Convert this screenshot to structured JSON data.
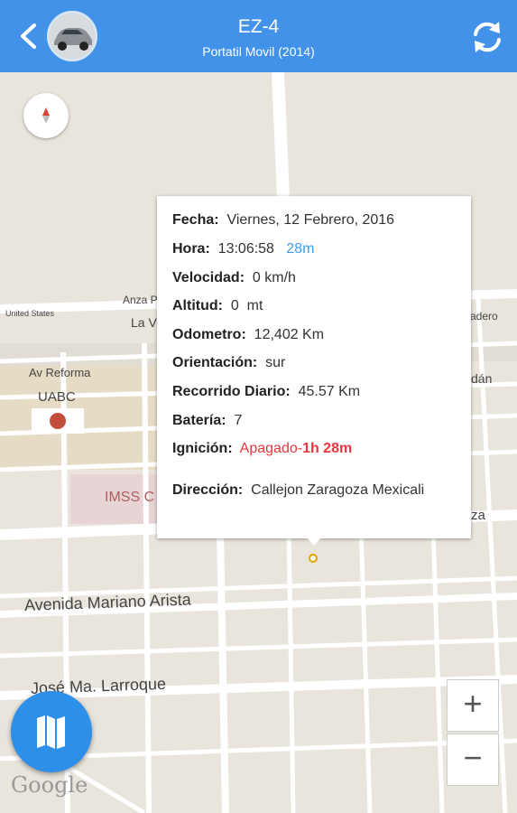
{
  "header": {
    "title": "EZ-4",
    "subtitle": "Portatil Movil (2014)",
    "back_icon": "chevron-left-icon",
    "refresh_icon": "refresh-icon",
    "avatar": "car-photo"
  },
  "map": {
    "labels": {
      "anza": "Anza P",
      "united_states": "United States",
      "la_v": "La V",
      "madero": "adero",
      "av_reforma": "Av Reforma",
      "uabc": "UABC",
      "imss": "IMSS C",
      "dan": "dán",
      "zaragoza": "za",
      "mariano_arista": "Avenida Mariano Arista",
      "larroque": "José Ma. Larroque",
      "google": "Google"
    },
    "colors": {
      "background": "#e9e5dc",
      "road": "#ffffff",
      "campus": "#e6dcc6",
      "hospital": "#e8d4d4"
    }
  },
  "popup": {
    "fecha_label": "Fecha:",
    "fecha_value": "Viernes, 12 Febrero, 2016",
    "hora_label": "Hora:",
    "hora_value": "13:06:58",
    "hora_extra": "28m",
    "velocidad_label": "Velocidad:",
    "velocidad_value": "0 km/h",
    "altitud_label": "Altitud:",
    "altitud_value": "0  mt",
    "odometro_label": "Odometro:",
    "odometro_value": "12,402 Km",
    "orientacion_label": "Orientación:",
    "orientacion_value": "sur",
    "recorrido_label": "Recorrido Diario:",
    "recorrido_value": "45.57 Km",
    "bateria_label": "Batería:",
    "bateria_value": "7",
    "ignicion_label": "Ignición:",
    "ignicion_value": "Apagado-",
    "ignicion_duration": "1h 28m",
    "direccion_label": "Dirección:",
    "direccion_value": "Callejon Zaragoza Mexicali"
  },
  "controls": {
    "zoom_in": "+",
    "zoom_out": "−",
    "map_icon": "map-icon",
    "compass_icon": "compass-icon"
  },
  "colors": {
    "header": "#4392e9",
    "accent_blue": "#3d9be9",
    "ignition_red": "#e8373d",
    "fab": "#2d8fe8"
  }
}
